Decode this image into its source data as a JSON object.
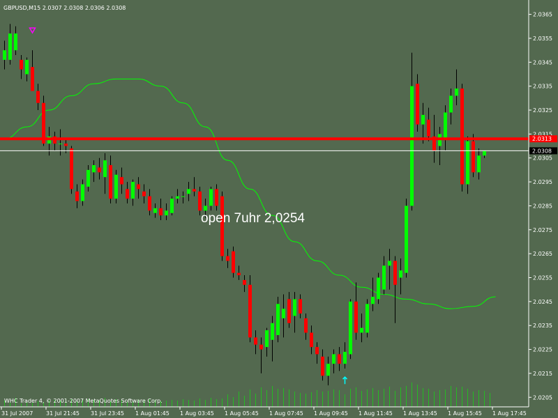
{
  "chart_data": {
    "type": "candlestick",
    "symbol_header": "GBPUSD,M15  2.0307 2.0308 2.0306 2.0308",
    "copyright": "WHC Trader 4, © 2001-2007 MetaQuotes Software Corp.",
    "annotation": "open 7uhr 2,0254",
    "colors": {
      "background": "#53694f",
      "bull": "#00ff00",
      "bear": "#ff0000",
      "ma_line": "#00ff00",
      "resistance_line": "#ff0000",
      "bid_line": "#ffffff",
      "volume": "#00ff00",
      "axis_text": "#ffffff",
      "arrow_down_marker": "#ff00ff",
      "arrow_up_marker": "#00ffff"
    },
    "ylim": [
      2.0201,
      2.0371
    ],
    "y_ticks": [
      "2.0365",
      "2.0355",
      "2.0345",
      "2.0335",
      "2.0325",
      "2.0315",
      "2.0305",
      "2.0295",
      "2.0285",
      "2.0275",
      "2.0265",
      "2.0255",
      "2.0245",
      "2.0235",
      "2.0225",
      "2.0215",
      "2.0205"
    ],
    "x_labels": [
      "31 Jul 2007",
      "31 Jul 21:45",
      "31 Jul 23:45",
      "1 Aug 01:45",
      "1 Aug 03:45",
      "1 Aug 05:45",
      "1 Aug 07:45",
      "1 Aug 09:45",
      "1 Aug 11:45",
      "1 Aug 13:45",
      "1 Aug 15:45",
      "1 Aug 17:45"
    ],
    "resistance_level": 2.0313,
    "resistance_label": "2.0313",
    "bid_level": 2.0308,
    "bid_label": "2.0308",
    "candles": [
      {
        "o": 2.0346,
        "h": 2.0354,
        "l": 2.0342,
        "c": 2.035
      },
      {
        "o": 2.0346,
        "h": 2.0361,
        "l": 2.0344,
        "c": 2.0357
      },
      {
        "o": 2.035,
        "h": 2.036,
        "l": 2.0348,
        "c": 2.0357
      },
      {
        "o": 2.0346,
        "h": 2.0348,
        "l": 2.0338,
        "c": 2.0342
      },
      {
        "o": 2.034,
        "h": 2.0347,
        "l": 2.0337,
        "c": 2.0346
      },
      {
        "o": 2.0343,
        "h": 2.035,
        "l": 2.0335,
        "c": 2.0333
      },
      {
        "o": 2.0333,
        "h": 2.0336,
        "l": 2.0325,
        "c": 2.0328
      },
      {
        "o": 2.0328,
        "h": 2.0331,
        "l": 2.031,
        "c": 2.0311
      },
      {
        "o": 2.0311,
        "h": 2.0318,
        "l": 2.0306,
        "c": 2.0314
      },
      {
        "o": 2.0314,
        "h": 2.0316,
        "l": 2.0308,
        "c": 2.0311
      },
      {
        "o": 2.0311,
        "h": 2.0317,
        "l": 2.0306,
        "c": 2.0311
      },
      {
        "o": 2.0311,
        "h": 2.0313,
        "l": 2.0307,
        "c": 2.031
      },
      {
        "o": 2.0309,
        "h": 2.031,
        "l": 2.029,
        "c": 2.0292
      },
      {
        "o": 2.0291,
        "h": 2.0294,
        "l": 2.0284,
        "c": 2.0287
      },
      {
        "o": 2.0287,
        "h": 2.0296,
        "l": 2.0285,
        "c": 2.0294
      },
      {
        "o": 2.0293,
        "h": 2.0302,
        "l": 2.0291,
        "c": 2.03
      },
      {
        "o": 2.0299,
        "h": 2.0304,
        "l": 2.0295,
        "c": 2.0302
      },
      {
        "o": 2.0301,
        "h": 2.0305,
        "l": 2.0296,
        "c": 2.0299
      },
      {
        "o": 2.0297,
        "h": 2.0307,
        "l": 2.029,
        "c": 2.0304
      },
      {
        "o": 2.0302,
        "h": 2.0306,
        "l": 2.0286,
        "c": 2.0288
      },
      {
        "o": 2.0288,
        "h": 2.03,
        "l": 2.0286,
        "c": 2.0298
      },
      {
        "o": 2.0297,
        "h": 2.0301,
        "l": 2.029,
        "c": 2.0294
      },
      {
        "o": 2.0292,
        "h": 2.0295,
        "l": 2.0286,
        "c": 2.0288
      },
      {
        "o": 2.0288,
        "h": 2.0296,
        "l": 2.0285,
        "c": 2.0295
      },
      {
        "o": 2.0294,
        "h": 2.0297,
        "l": 2.0288,
        "c": 2.0292
      },
      {
        "o": 2.0291,
        "h": 2.0294,
        "l": 2.0286,
        "c": 2.0289
      },
      {
        "o": 2.0289,
        "h": 2.0292,
        "l": 2.0281,
        "c": 2.0283
      },
      {
        "o": 2.0282,
        "h": 2.0286,
        "l": 2.028,
        "c": 2.0284
      },
      {
        "o": 2.0284,
        "h": 2.0288,
        "l": 2.0279,
        "c": 2.0281
      },
      {
        "o": 2.0281,
        "h": 2.0286,
        "l": 2.0279,
        "c": 2.0283
      },
      {
        "o": 2.0282,
        "h": 2.0289,
        "l": 2.0281,
        "c": 2.0288
      },
      {
        "o": 2.0288,
        "h": 2.0292,
        "l": 2.0286,
        "c": 2.0289
      },
      {
        "o": 2.0289,
        "h": 2.0291,
        "l": 2.0286,
        "c": 2.0289
      },
      {
        "o": 2.029,
        "h": 2.0295,
        "l": 2.0287,
        "c": 2.0292
      },
      {
        "o": 2.0292,
        "h": 2.0297,
        "l": 2.0289,
        "c": 2.0291
      },
      {
        "o": 2.0291,
        "h": 2.0293,
        "l": 2.0281,
        "c": 2.0283
      },
      {
        "o": 2.0283,
        "h": 2.0288,
        "l": 2.028,
        "c": 2.0285
      },
      {
        "o": 2.0285,
        "h": 2.0293,
        "l": 2.0283,
        "c": 2.0292
      },
      {
        "o": 2.0292,
        "h": 2.0294,
        "l": 2.0283,
        "c": 2.0285
      },
      {
        "o": 2.0289,
        "h": 2.0291,
        "l": 2.0262,
        "c": 2.0264
      },
      {
        "o": 2.0264,
        "h": 2.0267,
        "l": 2.0259,
        "c": 2.0262
      },
      {
        "o": 2.0266,
        "h": 2.0268,
        "l": 2.0255,
        "c": 2.0257
      },
      {
        "o": 2.0257,
        "h": 2.026,
        "l": 2.0254,
        "c": 2.0256
      },
      {
        "o": 2.0254,
        "h": 2.0256,
        "l": 2.0249,
        "c": 2.0252
      },
      {
        "o": 2.0252,
        "h": 2.0256,
        "l": 2.0228,
        "c": 2.023
      },
      {
        "o": 2.023,
        "h": 2.0233,
        "l": 2.0223,
        "c": 2.0227
      },
      {
        "o": 2.0227,
        "h": 2.023,
        "l": 2.0215,
        "c": 2.0225
      },
      {
        "o": 2.0226,
        "h": 2.0234,
        "l": 2.0222,
        "c": 2.0233
      },
      {
        "o": 2.0229,
        "h": 2.0239,
        "l": 2.022,
        "c": 2.0236
      },
      {
        "o": 2.0231,
        "h": 2.0247,
        "l": 2.0228,
        "c": 2.0244
      },
      {
        "o": 2.0238,
        "h": 2.0248,
        "l": 2.023,
        "c": 2.0242
      },
      {
        "o": 2.0246,
        "h": 2.0249,
        "l": 2.0234,
        "c": 2.0236
      },
      {
        "o": 2.0239,
        "h": 2.0249,
        "l": 2.0232,
        "c": 2.0246
      },
      {
        "o": 2.0246,
        "h": 2.0248,
        "l": 2.0238,
        "c": 2.024
      },
      {
        "o": 2.0238,
        "h": 2.024,
        "l": 2.0229,
        "c": 2.0232
      },
      {
        "o": 2.0232,
        "h": 2.0235,
        "l": 2.0223,
        "c": 2.0226
      },
      {
        "o": 2.0226,
        "h": 2.0228,
        "l": 2.0219,
        "c": 2.0223
      },
      {
        "o": 2.0222,
        "h": 2.0225,
        "l": 2.0212,
        "c": 2.0214
      },
      {
        "o": 2.0214,
        "h": 2.0222,
        "l": 2.021,
        "c": 2.0219
      },
      {
        "o": 2.0219,
        "h": 2.0225,
        "l": 2.0215,
        "c": 2.0223
      },
      {
        "o": 2.0223,
        "h": 2.0226,
        "l": 2.0216,
        "c": 2.0219
      },
      {
        "o": 2.0219,
        "h": 2.0228,
        "l": 2.0217,
        "c": 2.0224
      },
      {
        "o": 2.0223,
        "h": 2.0246,
        "l": 2.0221,
        "c": 2.0245
      },
      {
        "o": 2.0245,
        "h": 2.0253,
        "l": 2.0229,
        "c": 2.0232
      },
      {
        "o": 2.0232,
        "h": 2.024,
        "l": 2.0228,
        "c": 2.0234
      },
      {
        "o": 2.0232,
        "h": 2.0246,
        "l": 2.023,
        "c": 2.0244
      },
      {
        "o": 2.0244,
        "h": 2.0255,
        "l": 2.0241,
        "c": 2.0247
      },
      {
        "o": 2.0246,
        "h": 2.0257,
        "l": 2.0244,
        "c": 2.0255
      },
      {
        "o": 2.025,
        "h": 2.0264,
        "l": 2.0248,
        "c": 2.026
      },
      {
        "o": 2.026,
        "h": 2.0267,
        "l": 2.025,
        "c": 2.0262
      },
      {
        "o": 2.0262,
        "h": 2.0264,
        "l": 2.0236,
        "c": 2.0252
      },
      {
        "o": 2.0255,
        "h": 2.0263,
        "l": 2.0248,
        "c": 2.0258
      },
      {
        "o": 2.0257,
        "h": 2.0288,
        "l": 2.0255,
        "c": 2.0285
      },
      {
        "o": 2.0285,
        "h": 2.0349,
        "l": 2.0283,
        "c": 2.0335
      },
      {
        "o": 2.0336,
        "h": 2.034,
        "l": 2.0316,
        "c": 2.0319
      },
      {
        "o": 2.0319,
        "h": 2.0328,
        "l": 2.0311,
        "c": 2.0323
      },
      {
        "o": 2.0321,
        "h": 2.0326,
        "l": 2.0312,
        "c": 2.0314
      },
      {
        "o": 2.0314,
        "h": 2.0323,
        "l": 2.0303,
        "c": 2.0308
      },
      {
        "o": 2.031,
        "h": 2.0318,
        "l": 2.0302,
        "c": 2.0315
      },
      {
        "o": 2.0313,
        "h": 2.0327,
        "l": 2.0308,
        "c": 2.0324
      },
      {
        "o": 2.0324,
        "h": 2.0334,
        "l": 2.0319,
        "c": 2.0331
      },
      {
        "o": 2.0331,
        "h": 2.0342,
        "l": 2.0327,
        "c": 2.0334
      },
      {
        "o": 2.0334,
        "h": 2.0336,
        "l": 2.0291,
        "c": 2.0294
      },
      {
        "o": 2.0294,
        "h": 2.0314,
        "l": 2.029,
        "c": 2.0312
      },
      {
        "o": 2.0312,
        "h": 2.0315,
        "l": 2.0297,
        "c": 2.0299
      },
      {
        "o": 2.0299,
        "h": 2.0309,
        "l": 2.0296,
        "c": 2.0306
      },
      {
        "o": 2.0306,
        "h": 2.0308,
        "l": 2.0305,
        "c": 2.0308
      }
    ],
    "moving_average": [
      {
        "i": 0,
        "v": 2.0313
      },
      {
        "i": 4,
        "v": 2.0318
      },
      {
        "i": 8,
        "v": 2.0325
      },
      {
        "i": 12,
        "v": 2.0331
      },
      {
        "i": 16,
        "v": 2.0336
      },
      {
        "i": 20,
        "v": 2.0338
      },
      {
        "i": 24,
        "v": 2.0338
      },
      {
        "i": 28,
        "v": 2.0335
      },
      {
        "i": 32,
        "v": 2.0328
      },
      {
        "i": 36,
        "v": 2.0318
      },
      {
        "i": 40,
        "v": 2.0304
      },
      {
        "i": 44,
        "v": 2.0292
      },
      {
        "i": 48,
        "v": 2.0281
      },
      {
        "i": 52,
        "v": 2.027
      },
      {
        "i": 56,
        "v": 2.0262
      },
      {
        "i": 60,
        "v": 2.0256
      },
      {
        "i": 64,
        "v": 2.0251
      },
      {
        "i": 68,
        "v": 2.0248
      },
      {
        "i": 72,
        "v": 2.0246
      },
      {
        "i": 76,
        "v": 2.0244
      },
      {
        "i": 80,
        "v": 2.0242
      },
      {
        "i": 84,
        "v": 2.0243
      },
      {
        "i": 88,
        "v": 2.0247
      }
    ],
    "volume": [
      9,
      6,
      13,
      5,
      8,
      6,
      8,
      7,
      9,
      10,
      9,
      12,
      11,
      8,
      12,
      11,
      10,
      9,
      13,
      8,
      11,
      10,
      9,
      8,
      10,
      9,
      11,
      10,
      8,
      9,
      10,
      9,
      11,
      10,
      9,
      12,
      10,
      13,
      11,
      12,
      18,
      14,
      22,
      16,
      25,
      19,
      28,
      24,
      30,
      26,
      27,
      25,
      22,
      20,
      19,
      21,
      24,
      22,
      23,
      25,
      24,
      18,
      26,
      28,
      23,
      25,
      27,
      24,
      26,
      29,
      23,
      28,
      30,
      35,
      32,
      27,
      26,
      22,
      24,
      25,
      30,
      28,
      29,
      26,
      22,
      24,
      23,
      20
    ]
  }
}
